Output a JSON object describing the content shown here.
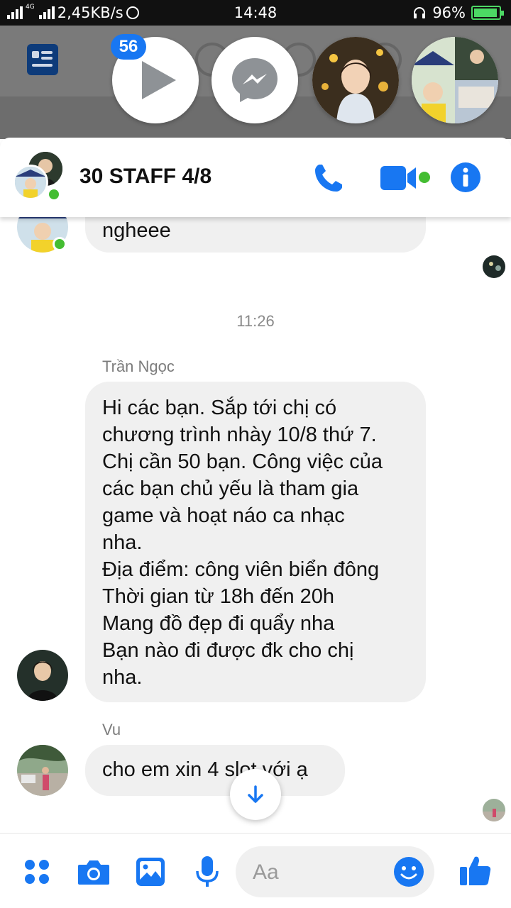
{
  "status_bar": {
    "network_type": "4G",
    "speed": "2,45KB/s",
    "time": "14:48",
    "battery": "96%"
  },
  "chat_heads": {
    "badge_count": "56"
  },
  "chat": {
    "title": "30 STAFF 4/8",
    "accent_color": "#1877f2"
  },
  "messages": {
    "partial_text": "ngheee",
    "timestamp": "11:26",
    "msg1_sender": "Trần Ngọc",
    "msg1_lines": [
      "Hi các bạn. Sắp tới chị có",
      "chương trình nhày 10/8 thứ 7.",
      "Chị cần 50 bạn. Công việc của",
      "các bạn chủ yếu là tham gia",
      "game và hoạt náo ca nhạc",
      "nha.",
      "Địa điểm: công viên biển đông",
      "Thời gian từ 18h đến 20h",
      "Mang đồ đẹp đi quẩy nha",
      "Bạn nào đi được đk cho chị",
      "nha."
    ],
    "msg2_sender": "Vu",
    "msg2_text": "cho em xin 4 slot với ạ"
  },
  "composer": {
    "placeholder": "Aa"
  }
}
